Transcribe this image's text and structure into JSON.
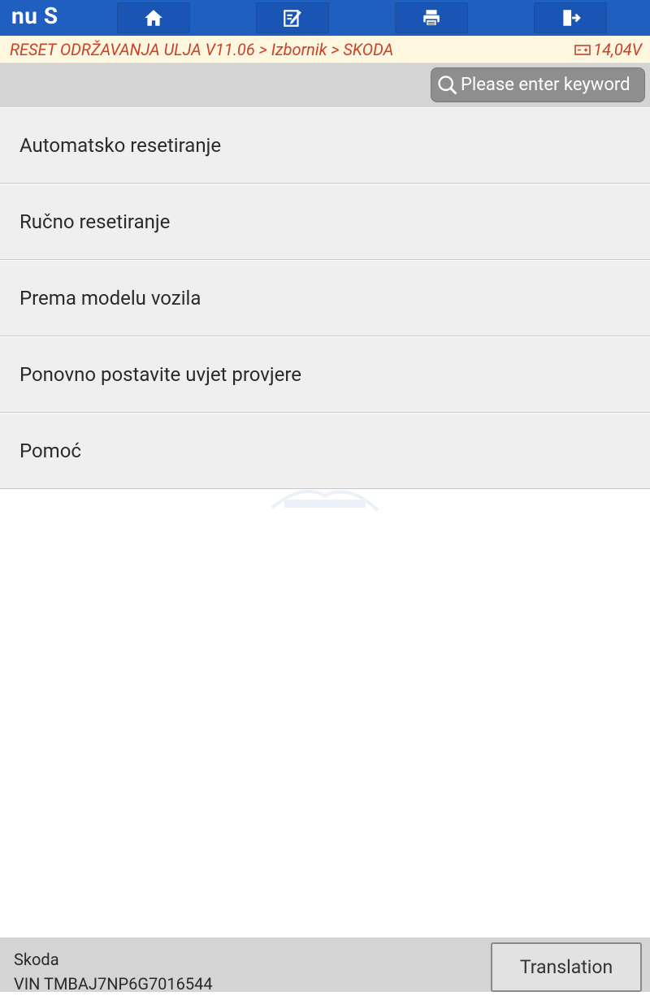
{
  "header": {
    "app_title": "nu S",
    "buttons": [
      {
        "icon": "home-icon"
      },
      {
        "icon": "edit-report-icon"
      },
      {
        "icon": "print-icon"
      },
      {
        "icon": "exit-icon"
      }
    ]
  },
  "breadcrumb": {
    "path": "RESET ODRŽAVANJA ULJA V11.06 > Izbornik > SKODA",
    "voltage": "14,04V"
  },
  "search": {
    "placeholder": "Please enter keyword"
  },
  "menu": {
    "items": [
      {
        "label": "Automatsko resetiranje"
      },
      {
        "label": "Ručno resetiranje"
      },
      {
        "label": "Prema modelu vozila"
      },
      {
        "label": "Ponovno postavite uvjet provjere"
      },
      {
        "label": "Pomoć"
      }
    ]
  },
  "footer": {
    "make": "Skoda",
    "vin": "VIN TMBAJ7NP6G7016544",
    "translation_label": "Translation"
  },
  "colors": {
    "toolbar": "#1f5fbf",
    "breadcrumb_bg": "#fdf7df",
    "breadcrumb_text": "#c8432d",
    "list_bg": "#efefef",
    "footer_bg": "#d4d4d4"
  }
}
